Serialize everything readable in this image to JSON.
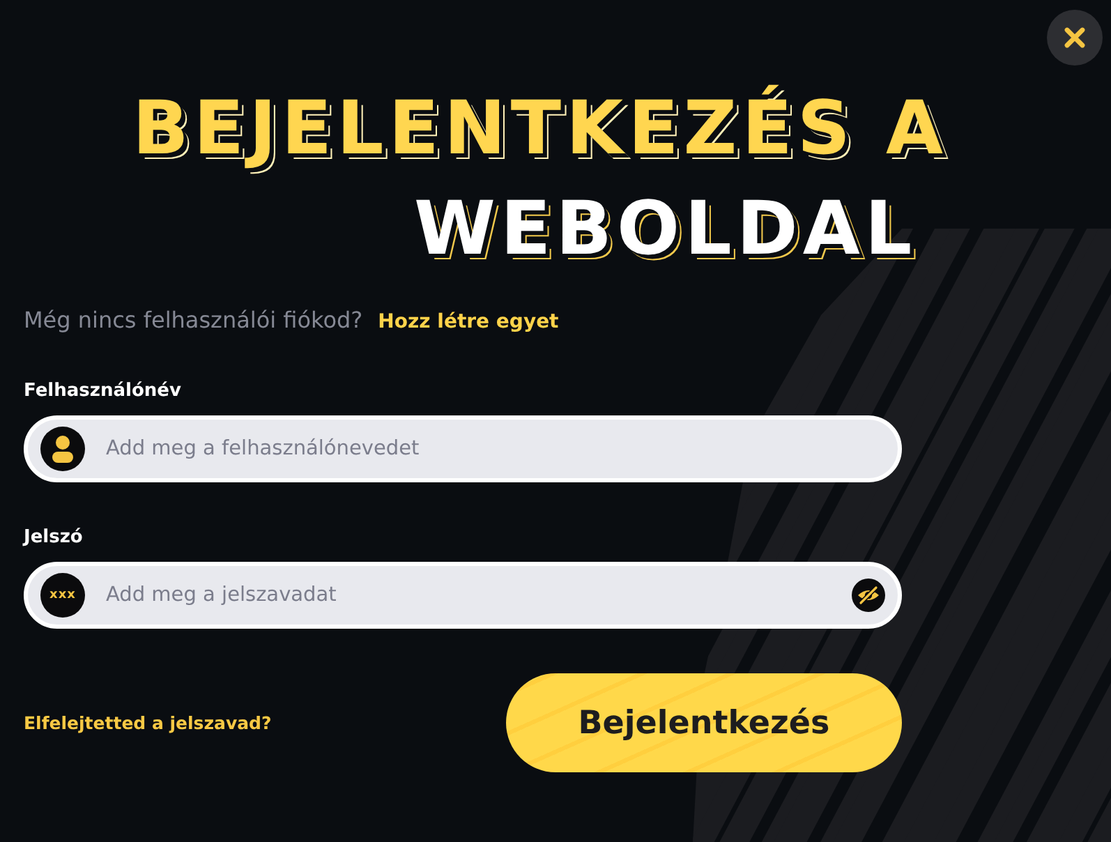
{
  "heading": [
    {
      "text": "BEJELENTKEZÉS A",
      "kind": "accent"
    },
    {
      "text": "WEBOLDAL",
      "kind": "plain"
    }
  ],
  "signup_prompt": {
    "text": "Még nincs felhasználói fiókod?",
    "link": "Hozz létre egyet"
  },
  "fields": [
    {
      "kind": "username",
      "label": "Felhasználónév",
      "placeholder": "Add meg a felhasználónevedet"
    },
    {
      "kind": "password",
      "label": "Jelszó",
      "placeholder": "Add meg a jelszavadat",
      "badge": "xxx",
      "revealed": false
    }
  ],
  "forgot_link": "Elfelejtetted a jelszavad?",
  "submit_button": "Bejelentkezés"
}
